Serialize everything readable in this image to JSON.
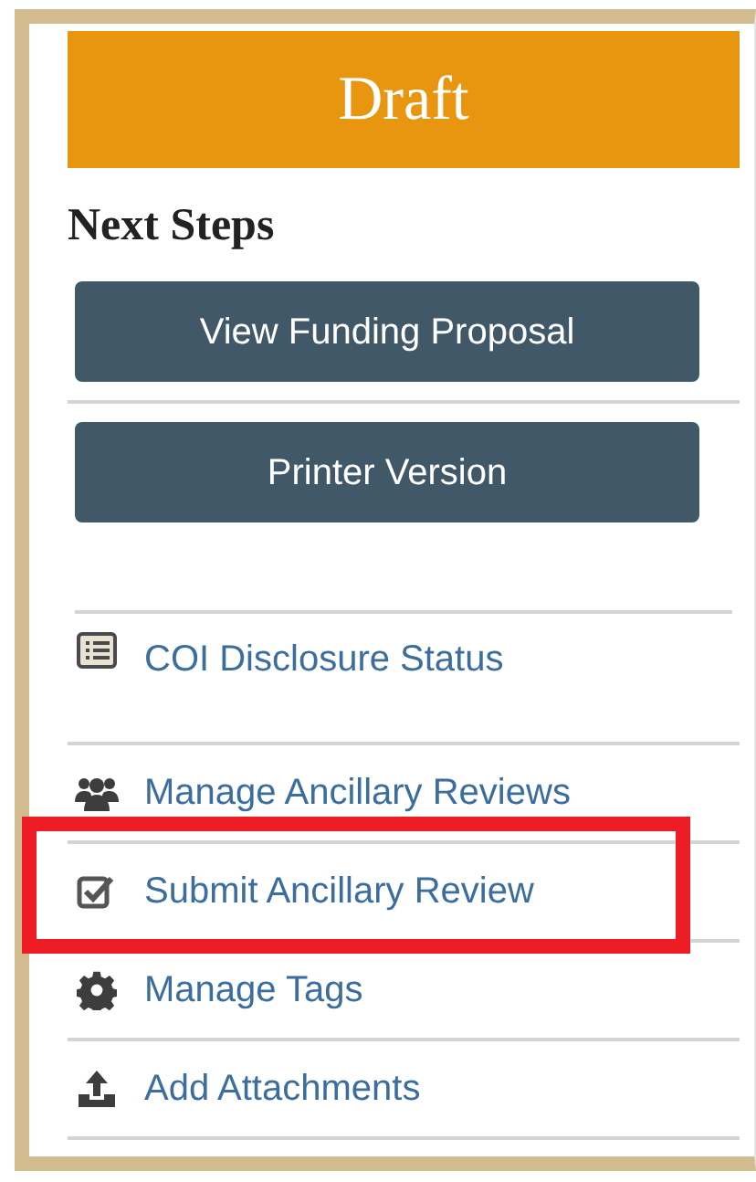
{
  "status_banner": {
    "label": "Draft"
  },
  "heading": "Next Steps",
  "buttons": [
    {
      "label": "View Funding Proposal"
    },
    {
      "label": "Printer Version"
    }
  ],
  "actions": [
    {
      "kind": "list",
      "label": "COI Disclosure Status",
      "highlighted": false
    },
    {
      "kind": "people",
      "label": "Manage Ancillary Reviews",
      "highlighted": false
    },
    {
      "kind": "check",
      "label": "Submit Ancillary Review",
      "highlighted": true
    },
    {
      "kind": "gear",
      "label": "Manage Tags",
      "highlighted": false
    },
    {
      "kind": "upload",
      "label": "Add Attachments",
      "highlighted": false
    }
  ]
}
